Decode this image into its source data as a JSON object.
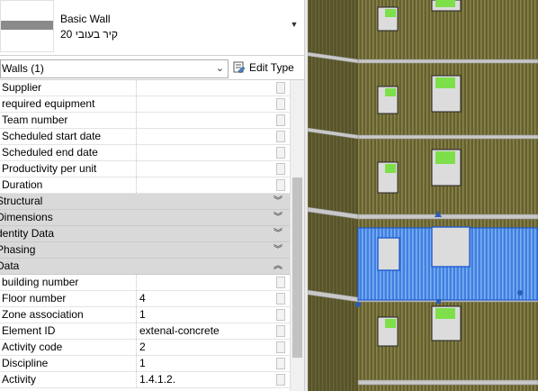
{
  "type_selector": {
    "family": "Basic Wall",
    "type_name": "קיר בעובי 20"
  },
  "instance": {
    "selector_label": "Walls (1)",
    "edit_type_label": "Edit Type"
  },
  "properties": [
    {
      "name": "Supplier",
      "value": ""
    },
    {
      "name": "required equipment",
      "value": ""
    },
    {
      "name": "Team number",
      "value": ""
    },
    {
      "name": "Scheduled start date",
      "value": ""
    },
    {
      "name": "Scheduled end date",
      "value": ""
    },
    {
      "name": "Productivity per unit",
      "value": ""
    },
    {
      "name": "Duration",
      "value": ""
    }
  ],
  "groups": [
    {
      "label": "Structural",
      "state": "collapsed"
    },
    {
      "label": "Dimensions",
      "state": "collapsed"
    },
    {
      "label": "dentity Data",
      "state": "collapsed"
    },
    {
      "label": "Phasing",
      "state": "collapsed"
    },
    {
      "label": "Data",
      "state": "expanded"
    }
  ],
  "data_properties": [
    {
      "name": "building number",
      "value": ""
    },
    {
      "name": "Floor number",
      "value": "4"
    },
    {
      "name": "Zone association",
      "value": "1"
    },
    {
      "name": "Element ID",
      "value": "extenal-concrete"
    },
    {
      "name": "Activity code",
      "value": "2"
    },
    {
      "name": "Discipline",
      "value": "1"
    },
    {
      "name": "Activity",
      "value": "1.4.1.2."
    }
  ],
  "icons": {
    "collapsed": "double-chevron-down-icon",
    "expanded": "double-chevron-up-icon",
    "edit_type": "edit-type-icon",
    "dropdown": "dropdown-arrow-icon"
  },
  "colors": {
    "group_header": "#d9d9d9",
    "wall_olive": "#6f6a36",
    "slab_gray": "#c8c8c8",
    "selection_blue": "#3f86e8",
    "window_green": "#7de04a"
  }
}
